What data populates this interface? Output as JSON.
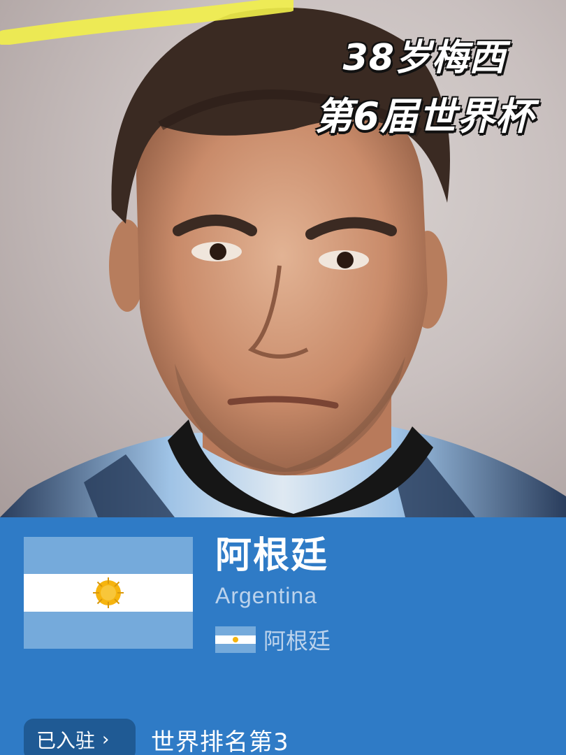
{
  "caption": {
    "line1": "38岁梅西",
    "line2": "第6届世界杯"
  },
  "country": {
    "name_zh": "阿根廷",
    "name_en": "Argentina",
    "flag_label": "阿根廷"
  },
  "actions": {
    "join_label": "已入驻",
    "rank_text": "世界排名第3"
  },
  "colors": {
    "panel_bg": "#2f7bc6",
    "flag_blue": "#75aadb",
    "flag_white": "#ffffff",
    "sun": "#f6b40e",
    "highlight": "#f2f04a"
  },
  "icons": {
    "flag": "argentina-flag-icon",
    "chevron": "chevron-right-icon"
  }
}
